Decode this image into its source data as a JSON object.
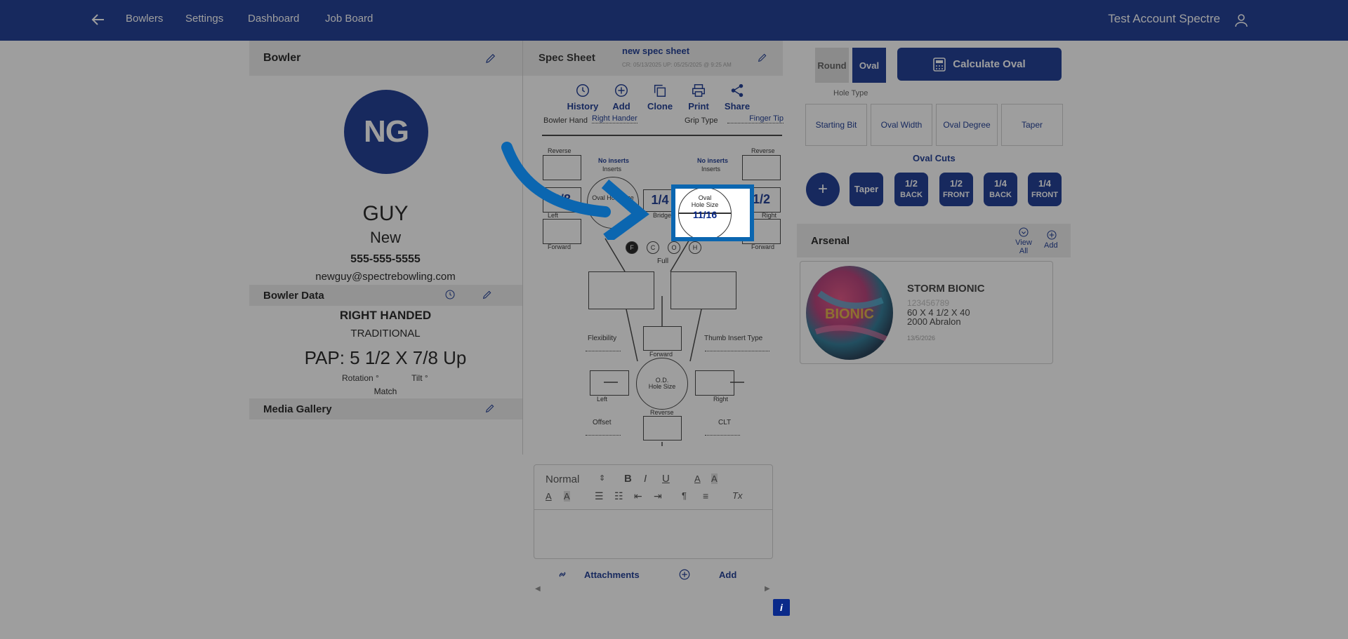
{
  "nav": {
    "links": [
      "Bowlers",
      "Settings",
      "Dashboard",
      "Job Board"
    ],
    "account_name": "Test Account Spectre"
  },
  "bowler": {
    "header": "Bowler",
    "initials": "NG",
    "first_name": "GUY",
    "last_name": "New",
    "phone": "555-555-5555",
    "email": "newguy@spectrebowling.com"
  },
  "bowler_data": {
    "header": "Bowler Data",
    "hand": "RIGHT HANDED",
    "grip": "TRADITIONAL",
    "pap": "PAP: 5 1/2 X 7/8 Up",
    "rotation": "Rotation °",
    "tilt": "Tilt °",
    "match": "Match"
  },
  "media": {
    "header": "Media Gallery"
  },
  "spec": {
    "header": "Spec Sheet",
    "name": "new spec sheet",
    "dates": "CR: 05/13/2025 UP: 05/25/2025 @ 9:25 AM",
    "tools": [
      "History",
      "Add",
      "Clone",
      "Print",
      "Share"
    ],
    "bowler_hand_label": "Bowler Hand",
    "bowler_hand_value": "Right Hander",
    "grip_type_label": "Grip Type",
    "grip_type_value": "Finger Tip",
    "left_finger": {
      "reverse": "Reverse",
      "inserts_none": "No inserts",
      "inserts": "Inserts",
      "left": "Left",
      "forward": "Forward",
      "value": "3/8",
      "hole": "Oval Hole Size"
    },
    "right_finger": {
      "reverse": "Reverse",
      "inserts_none": "No inserts",
      "inserts": "Inserts",
      "right": "Right",
      "forward": "Forward",
      "value": "1/2",
      "hole_oval": "Oval",
      "hole_size": "Hole Size",
      "hole_value": "11/16"
    },
    "bridge_value": "1/4",
    "bridge_label": "Bridge",
    "fit_circles": [
      "F",
      "C",
      "O",
      "H"
    ],
    "full": "Full",
    "flexibility": "Flexibility",
    "thumb_insert": "Thumb Insert Type",
    "thumb": {
      "forward": "Forward",
      "od": "O.D.",
      "hole_size": "Hole Size",
      "left": "Left",
      "right": "Right",
      "reverse": "Reverse"
    },
    "offset": "Offset",
    "clt": "CLT"
  },
  "editor": {
    "format": "Normal",
    "attachments": "Attachments",
    "add": "Add"
  },
  "oval": {
    "round": "Round",
    "oval": "Oval",
    "hole_type": "Hole Type",
    "calc_button": "Calculate Oval",
    "params": [
      "Starting Bit",
      "Oval Width",
      "Oval Degree",
      "Taper"
    ],
    "cuts_title": "Oval Cuts",
    "cut_buttons": [
      {
        "top": "Taper",
        "bottom": ""
      },
      {
        "top": "1/2",
        "bottom": "BACK"
      },
      {
        "top": "1/2",
        "bottom": "FRONT"
      },
      {
        "top": "1/4",
        "bottom": "BACK"
      },
      {
        "top": "1/4",
        "bottom": "FRONT"
      }
    ]
  },
  "arsenal": {
    "header": "Arsenal",
    "view_all": "View All",
    "add": "Add",
    "ball": {
      "name": "STORM BIONIC",
      "serial": "123456789",
      "layout": "60 X 4 1/2 X 40",
      "surface": "2000 Abralon",
      "date": "13/5/2026"
    }
  },
  "info": "i",
  "colors": {
    "brand": "#0a2a8a",
    "highlight": "#0b66b0"
  }
}
